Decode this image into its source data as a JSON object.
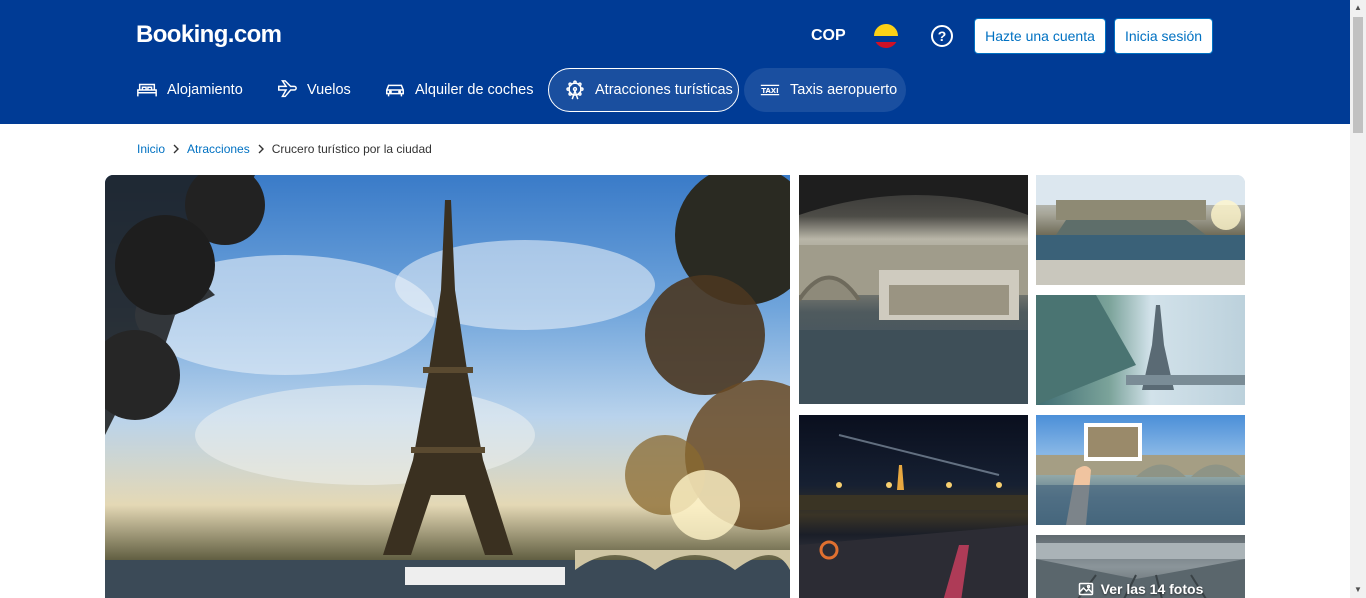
{
  "header": {
    "logo": "Booking.com",
    "currency": "COP",
    "flag_icon": "colombia-flag-icon",
    "help_icon": "help-icon",
    "help_glyph": "?",
    "register_label": "Hazte una cuenta",
    "login_label": "Inicia sesión",
    "bg_color": "#003b95"
  },
  "nav": {
    "items": [
      {
        "label": "Alojamiento",
        "icon": "bed-icon"
      },
      {
        "label": "Vuelos",
        "icon": "plane-icon"
      },
      {
        "label": "Alquiler de coches",
        "icon": "car-icon"
      },
      {
        "label": "Atracciones turísticas",
        "icon": "attractions-icon",
        "active": true
      },
      {
        "label": "Taxis aeropuerto",
        "icon": "taxi-icon"
      }
    ]
  },
  "breadcrumb": {
    "items": [
      "Inicio",
      "Atracciones",
      "Crucero turístico por la ciudad"
    ]
  },
  "gallery": {
    "more_photos_label": "Ver las 14 fotos",
    "photos": [
      "eiffel-tower-photo",
      "bridge-boat-photo",
      "tour-boat-photo",
      "eiffel-from-boat-photo",
      "night-cruise-photo",
      "postcard-bridge-photo",
      "boat-interior-photo"
    ]
  }
}
